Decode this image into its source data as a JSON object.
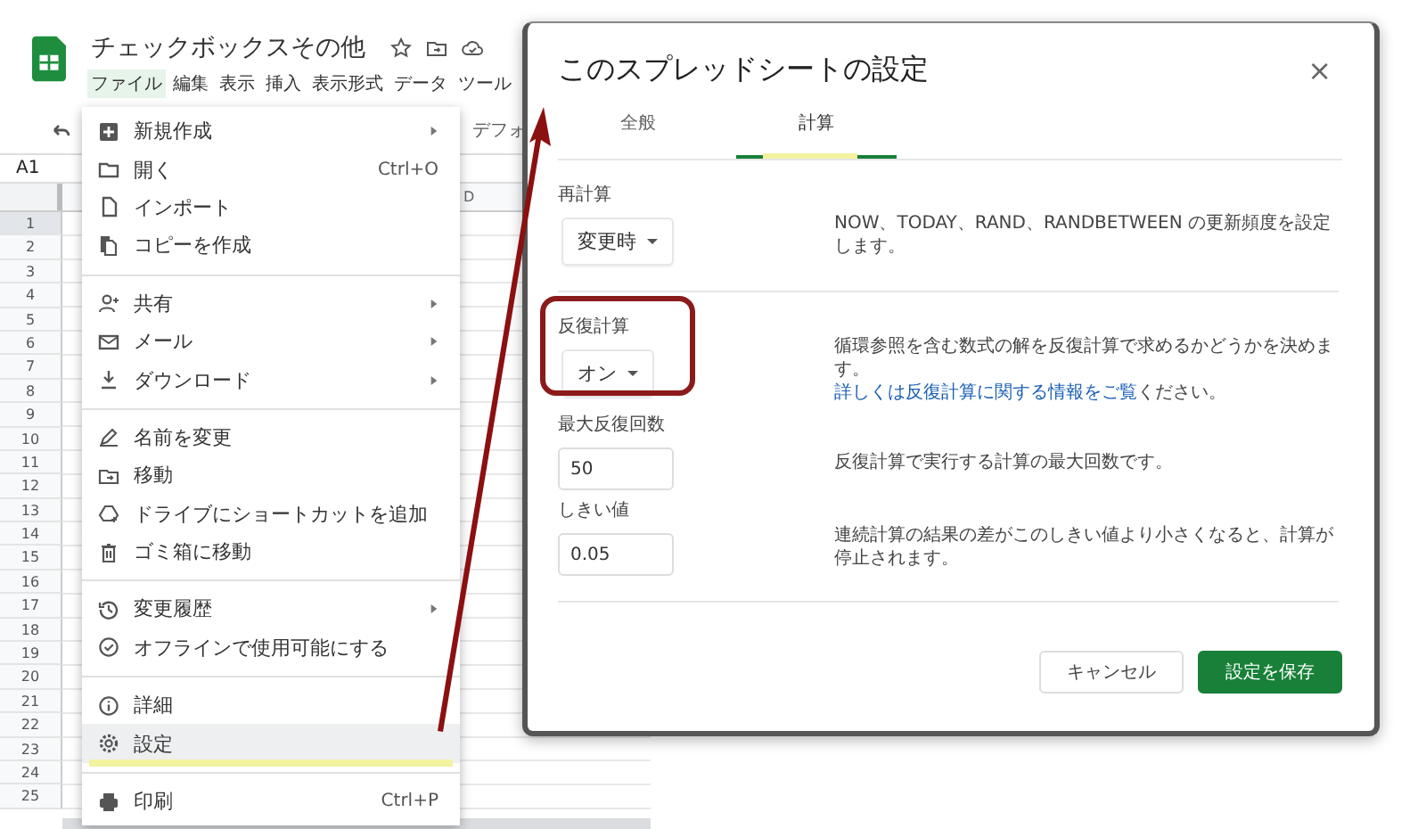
{
  "sheet": {
    "title": "チェックボックスその他",
    "menus": [
      {
        "label": "ファイル",
        "selected": true
      },
      {
        "label": "編集",
        "selected": false
      },
      {
        "label": "表示",
        "selected": false
      },
      {
        "label": "挿入",
        "selected": false
      },
      {
        "label": "表示形式",
        "selected": false
      },
      {
        "label": "データ",
        "selected": false
      },
      {
        "label": "ツール",
        "selected": false
      }
    ],
    "font_label": "デフォ",
    "name_box": "A1",
    "column_label": "D",
    "rows": [
      {
        "label": "1",
        "selected": true
      },
      {
        "label": "2",
        "selected": false
      },
      {
        "label": "3",
        "selected": false
      },
      {
        "label": "4",
        "selected": false
      },
      {
        "label": "5",
        "selected": false
      },
      {
        "label": "6",
        "selected": false
      },
      {
        "label": "7",
        "selected": false
      },
      {
        "label": "8",
        "selected": false
      },
      {
        "label": "9",
        "selected": false
      },
      {
        "label": "10",
        "selected": false
      },
      {
        "label": "11",
        "selected": false
      },
      {
        "label": "12",
        "selected": false
      },
      {
        "label": "13",
        "selected": false
      },
      {
        "label": "14",
        "selected": false
      },
      {
        "label": "15",
        "selected": false
      },
      {
        "label": "16",
        "selected": false
      },
      {
        "label": "17",
        "selected": false
      },
      {
        "label": "18",
        "selected": false
      },
      {
        "label": "19",
        "selected": false
      },
      {
        "label": "20",
        "selected": false
      },
      {
        "label": "21",
        "selected": false
      },
      {
        "label": "22",
        "selected": false
      },
      {
        "label": "23",
        "selected": false
      },
      {
        "label": "24",
        "selected": false
      },
      {
        "label": "25",
        "selected": false
      }
    ]
  },
  "file_menu": {
    "groups": [
      [
        {
          "label": "新規作成",
          "submenu": true,
          "selected": false
        },
        {
          "label": "開く",
          "shortcut": "Ctrl+O",
          "submenu": false,
          "selected": false
        },
        {
          "label": "インポート",
          "submenu": false,
          "selected": false
        },
        {
          "label": "コピーを作成",
          "submenu": false,
          "selected": false
        }
      ],
      [
        {
          "label": "共有",
          "submenu": true,
          "selected": false
        },
        {
          "label": "メール",
          "submenu": true,
          "selected": false
        },
        {
          "label": "ダウンロード",
          "submenu": true,
          "selected": false
        }
      ],
      [
        {
          "label": "名前を変更",
          "submenu": false,
          "selected": false
        },
        {
          "label": "移動",
          "submenu": false,
          "selected": false
        },
        {
          "label": "ドライブにショートカットを追加",
          "submenu": false,
          "selected": false
        },
        {
          "label": "ゴミ箱に移動",
          "submenu": false,
          "selected": false
        }
      ],
      [
        {
          "label": "変更履歴",
          "submenu": true,
          "selected": false
        },
        {
          "label": "オフラインで使用可能にする",
          "submenu": false,
          "selected": false
        }
      ],
      [
        {
          "label": "詳細",
          "submenu": false,
          "selected": false
        },
        {
          "label": "設定",
          "submenu": false,
          "selected": true
        }
      ],
      [
        {
          "label": "印刷",
          "shortcut": "Ctrl+P",
          "submenu": false,
          "selected": false
        }
      ]
    ]
  },
  "dialog": {
    "title": "このスプレッドシートの設定",
    "close": "×",
    "tabs": [
      {
        "label": "全般",
        "selected": false
      },
      {
        "label": "計算",
        "selected": true
      }
    ],
    "sections": [
      {
        "settings": [
          {
            "label": "再計算",
            "kind": "dropdown",
            "annotated": false,
            "value": "変更時",
            "description": "NOW、TODAY、RAND、RANDBETWEEN の更新頻度を設定します。"
          }
        ]
      },
      {
        "settings": [
          {
            "label": "反復計算",
            "kind": "dropdown",
            "annotated": true,
            "value": "オン",
            "description": "循環参照を含む数式の解を反復計算で求めるかどうかを決めます。",
            "link": "詳しくは反復計算に関する情報をご覧",
            "after_link": "ください。"
          },
          {
            "label": "最大反復回数",
            "kind": "input",
            "annotated": false,
            "value": "50",
            "description": "反復計算で実行する計算の最大回数です。"
          },
          {
            "label": "しきい値",
            "kind": "input",
            "annotated": false,
            "value": "0.05",
            "description": "連続計算の結果の差がこのしきい値より小さくなると、計算が停止されます。"
          }
        ]
      }
    ],
    "buttons": [
      {
        "label": "キャンセル",
        "kind": "secondary"
      },
      {
        "label": "設定を保存",
        "kind": "primary"
      }
    ]
  }
}
